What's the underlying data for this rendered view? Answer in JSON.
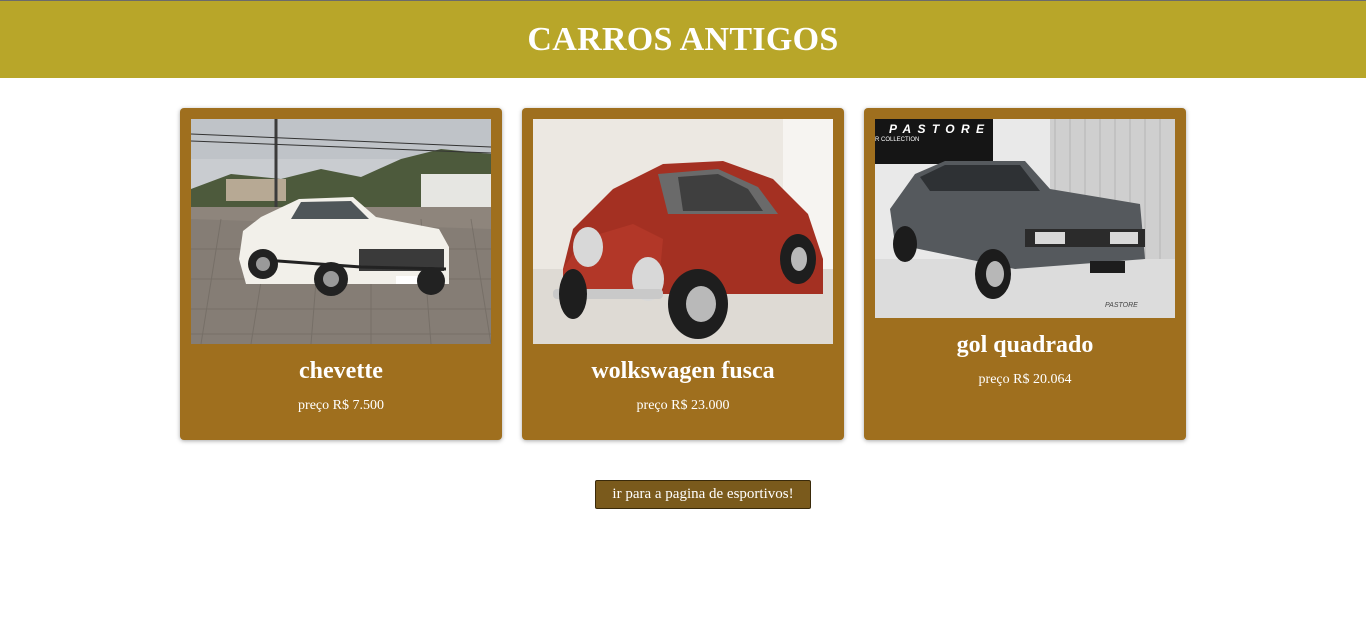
{
  "header": {
    "title": "CARROS ANTIGOS"
  },
  "cars": [
    {
      "name": "chevette",
      "price": "preço R$ 7.500",
      "image": "white-car-photo"
    },
    {
      "name": "wolkswagen fusca",
      "price": "preço R$ 23.000",
      "image": "red-beetle-photo"
    },
    {
      "name": "gol quadrado",
      "price": "preço R$ 20.064",
      "image": "gray-hatchback-photo"
    }
  ],
  "nav": {
    "button_label": "ir para a pagina de esportivos!"
  },
  "colors": {
    "header_bg": "#b8a629",
    "card_bg": "#9f6f1e",
    "button_bg": "#7a5a1c"
  }
}
